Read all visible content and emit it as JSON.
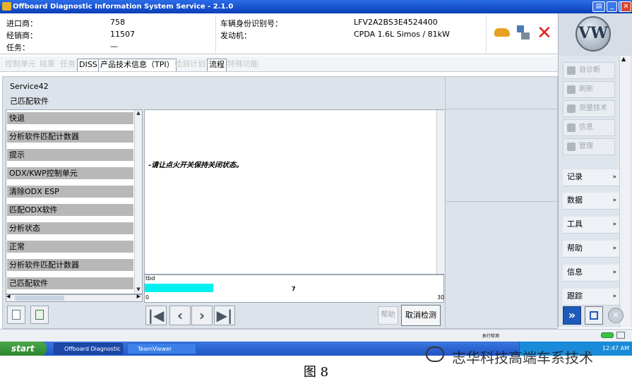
{
  "window": {
    "title": "Offboard Diagnostic Information System Service - 2.1.0"
  },
  "header": {
    "importer_label": "进口商：",
    "importer_value": "758",
    "dealer_label": "经销商：",
    "dealer_value": "11507",
    "task_label": "任务：",
    "task_value": "—",
    "vin_label": "车辆身份识别号：",
    "vin_value": "LFV2A2BS3E4524400",
    "engine_label": "发动机：",
    "engine_value": "CPDA 1.6L Simos / 81kW",
    "logo_text": "VW"
  },
  "tabs": [
    "控制单元",
    "结果",
    "任务",
    "DISS",
    "产品技术信息（TPI）",
    "检测计划",
    "流程",
    "特殊功能"
  ],
  "service": {
    "title": "Service42",
    "subtitle": "己匹配软件"
  },
  "left_list": [
    "快退",
    "分析软件匹配计数器",
    "提示",
    "ODX/KWP控制单元",
    "清除ODX ESP",
    "匹配ODX软件",
    "分析状态",
    "正常",
    "分析软件匹配计数器",
    "己匹配软件"
  ],
  "center": {
    "message": "-请让点火开关保持关闭状态。"
  },
  "progress": {
    "label": "tbd",
    "current": "7",
    "min": "0",
    "max": "30",
    "fraction": 0.23
  },
  "buttons": {
    "help": "帮助",
    "cancel_check": "取消检测"
  },
  "sidebar": {
    "actions": [
      {
        "label": "自诊断",
        "icon": "hand-icon"
      },
      {
        "label": "刷新",
        "icon": "refresh-icon"
      },
      {
        "label": "测量技术",
        "icon": "measure-icon"
      },
      {
        "label": "信息",
        "icon": "info-icon"
      },
      {
        "label": "管理",
        "icon": "gear-icon"
      }
    ],
    "sections": [
      "记录",
      "数据",
      "工具",
      "帮助",
      "信息",
      "跟踪"
    ]
  },
  "statusbar": {
    "text": "执行检测"
  },
  "taskbar": {
    "start": "start",
    "tasks": [
      "Offboard Diagnostic I...",
      "TeamViewer"
    ],
    "clock": "12:47 AM"
  },
  "watermark": "志华科技高端车系技术",
  "caption": "图 8"
}
